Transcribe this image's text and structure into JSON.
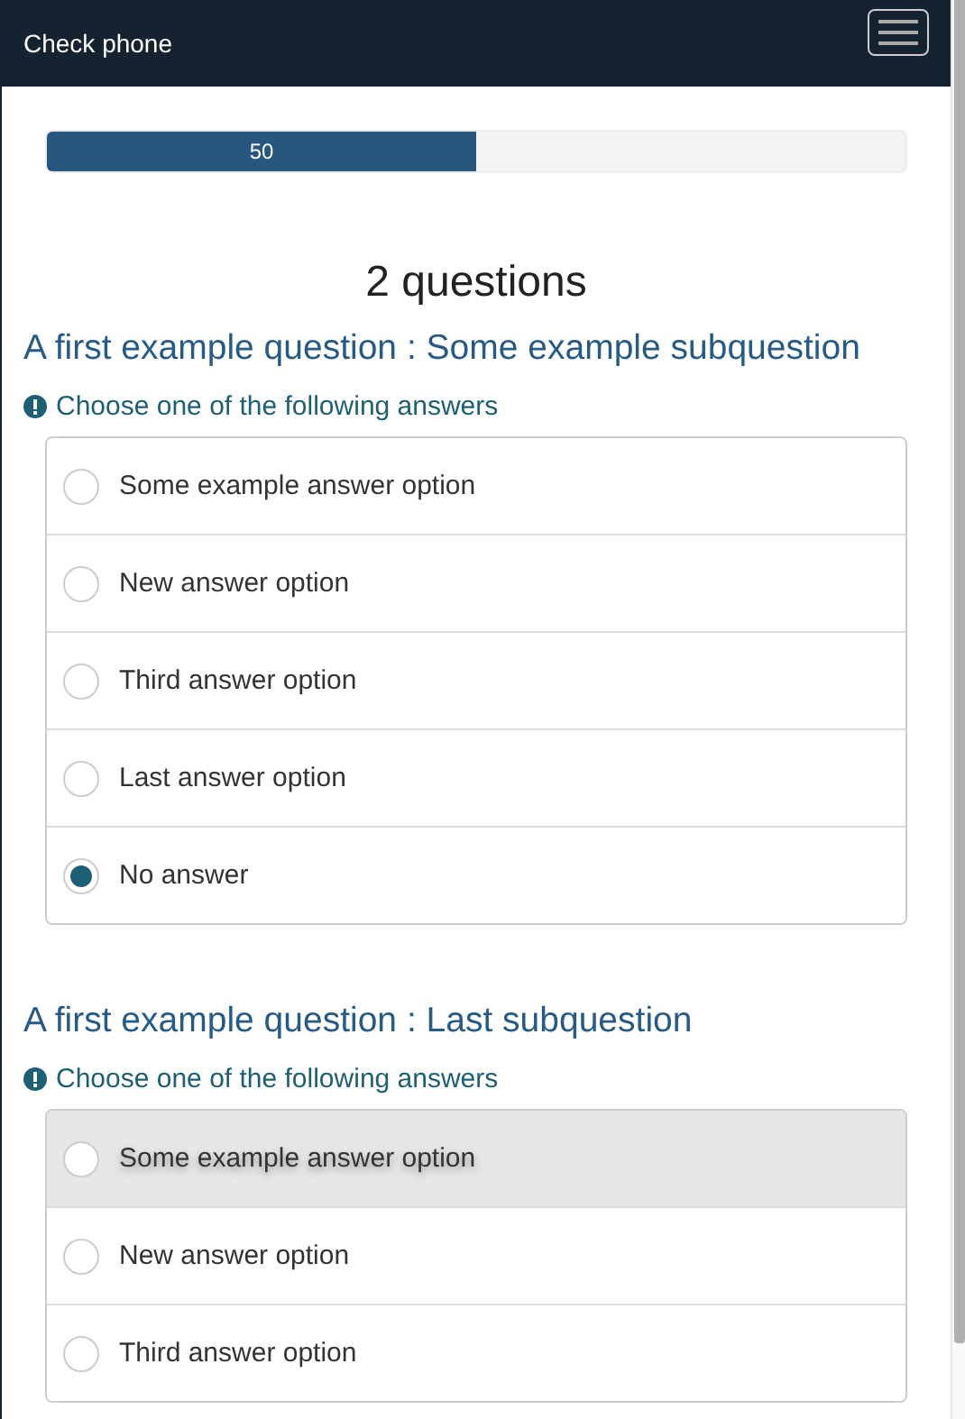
{
  "navbar": {
    "title": "Check phone"
  },
  "progress": {
    "level": 0.5,
    "label": "50"
  },
  "heading": "2 questions",
  "questions": [
    {
      "title": "A first example question : Some example subquestion",
      "hint": "Choose one of the following answers",
      "options": [
        {
          "label": "Some example answer option",
          "selected": false,
          "highlighted": false
        },
        {
          "label": "New answer option",
          "selected": false,
          "highlighted": false
        },
        {
          "label": "Third answer option",
          "selected": false,
          "highlighted": false
        },
        {
          "label": "Last answer option",
          "selected": false,
          "highlighted": false
        },
        {
          "label": "No answer",
          "selected": true,
          "highlighted": false
        }
      ]
    },
    {
      "title": "A first example question : Last subquestion",
      "hint": "Choose one of the following answers",
      "options": [
        {
          "label": "Some example answer option",
          "selected": false,
          "highlighted": true
        },
        {
          "label": "New answer option",
          "selected": false,
          "highlighted": false
        },
        {
          "label": "Third answer option",
          "selected": false,
          "highlighted": false
        }
      ]
    }
  ]
}
